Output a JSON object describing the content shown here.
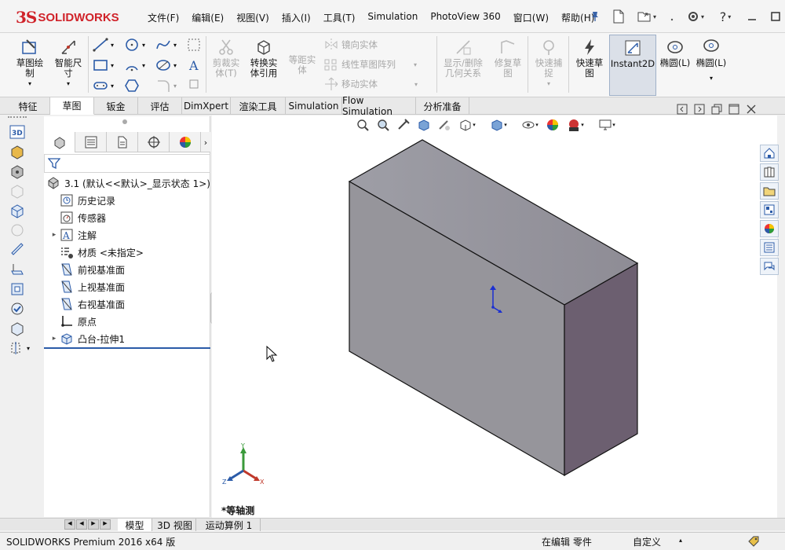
{
  "app": {
    "brand_ds": "3S",
    "brand_name": "SOLIDWORKS"
  },
  "menu": [
    "文件(F)",
    "编辑(E)",
    "视图(V)",
    "插入(I)",
    "工具(T)",
    "Simulation",
    "PhotoView 360",
    "窗口(W)",
    "帮助(H)"
  ],
  "window_controls": {
    "help": "?"
  },
  "ribbon": {
    "sketch": "草图绘\n制",
    "smart_dim": "智能尺\n寸",
    "trim": "剪裁实\n体(T)",
    "convert": "转换实\n体引用",
    "offset": "等距实\n体",
    "mirror": "镜向实体",
    "linear_pattern": "线性草图阵列",
    "move": "移动实体",
    "show_relations": "显示/删除\n几何关系",
    "repair": "修复草\n图",
    "quick_snap": "快速捕\n捉",
    "rapid_sketch": "快速草\n图",
    "instant2d": "Instant2D",
    "ellipse1": "椭圆(L)",
    "ellipse2": "椭圆(L)"
  },
  "tabs": [
    "特征",
    "草图",
    "钣金",
    "评估",
    "DimXpert",
    "渲染工具",
    "Simulation",
    "Flow Simulation",
    "分析准备"
  ],
  "active_tab": "草图",
  "tree": [
    {
      "label": "3.1  (默认<<默认>_显示状态 1>)",
      "icon": "part-icon",
      "expand": ""
    },
    {
      "label": "历史记录",
      "icon": "history-icon",
      "expand": ""
    },
    {
      "label": "传感器",
      "icon": "sensor-icon",
      "expand": ""
    },
    {
      "label": "注解",
      "icon": "annotation-icon",
      "expand": "▸"
    },
    {
      "label": "材质 <未指定>",
      "icon": "material-icon",
      "expand": ""
    },
    {
      "label": "前视基准面",
      "icon": "plane-icon",
      "expand": ""
    },
    {
      "label": "上视基准面",
      "icon": "plane-icon",
      "expand": ""
    },
    {
      "label": "右视基准面",
      "icon": "plane-icon",
      "expand": ""
    },
    {
      "label": "原点",
      "icon": "origin-icon",
      "expand": ""
    },
    {
      "label": "凸台-拉伸1",
      "icon": "extrude-icon",
      "expand": "▸"
    }
  ],
  "viewport": {
    "view_label": "*等轴测",
    "triad": {
      "x": "X",
      "y": "Y",
      "z": "Z"
    }
  },
  "bottom_tabs": [
    "模型",
    "3D 视图",
    "运动算例 1"
  ],
  "status": {
    "product": "SOLIDWORKS Premium 2016 x64 版",
    "mode": "在编辑 零件",
    "units": "自定义"
  }
}
